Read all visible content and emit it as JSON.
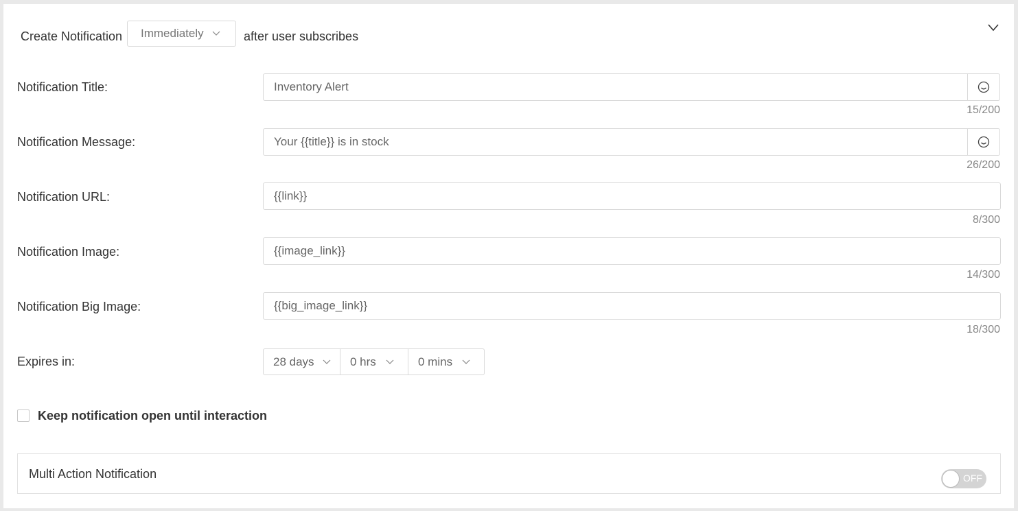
{
  "header": {
    "prefix": "Create Notification",
    "timing_dropdown": "Immediately",
    "suffix": "after user subscribes"
  },
  "fields": {
    "title": {
      "label": "Notification Title:",
      "value": "Inventory Alert",
      "counter": "15/200"
    },
    "message": {
      "label": "Notification Message:",
      "value": "Your {{title}} is in stock",
      "counter": "26/200"
    },
    "url": {
      "label": "Notification URL:",
      "value": "{{link}}",
      "counter": "8/300"
    },
    "image": {
      "label": "Notification Image:",
      "value": "{{image_link}}",
      "counter": "14/300"
    },
    "big_image": {
      "label": "Notification Big Image:",
      "value": "{{big_image_link}}",
      "counter": "18/300"
    }
  },
  "expires": {
    "label": "Expires in:",
    "days": "28 days",
    "hours": "0 hrs",
    "mins": "0 mins"
  },
  "keep_open": {
    "label": "Keep notification open until interaction",
    "checked": false
  },
  "multi_action": {
    "label": "Multi Action Notification",
    "toggle_text": "OFF"
  },
  "icons": {
    "collapse": "chevron-down-icon",
    "emoji": "smiley-icon"
  }
}
